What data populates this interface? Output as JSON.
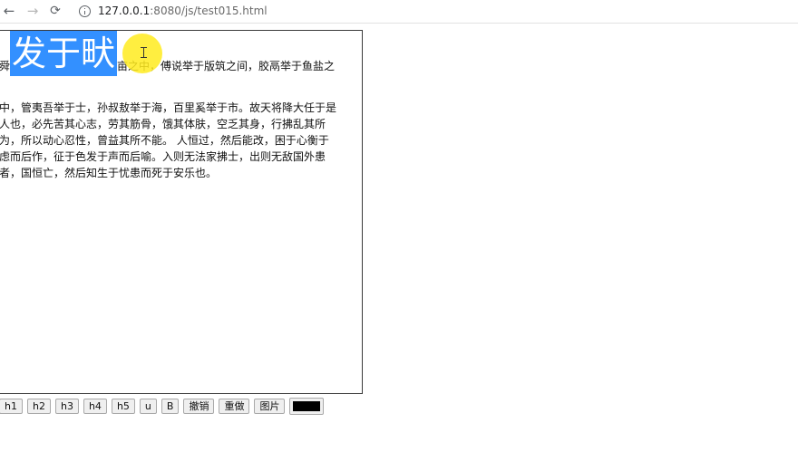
{
  "browser": {
    "url_host": "127.0.0.1",
    "url_path": ":8080/js/test015.html"
  },
  "editor": {
    "line1_a": "舜",
    "line1_selected": "发于畎",
    "line1_b": "亩之中，傅说举于版筑之间，胶鬲举于鱼盐之",
    "lines": [
      "中，管夷吾举于士，孙叔敖举于海，百里奚举于市。故天将降大任于是",
      "人也，必先苦其心志，劳其筋骨，饿其体肤，空乏其身，行拂乱其所",
      "为，所以动心忍性，曾益其所不能。 人恒过，然后能改，困于心衡于",
      "虑而后作，征于色发于声而后喻。入则无法家拂士，出则无敌国外患",
      "者，国恒亡，然后知生于忧患而死于安乐也。"
    ]
  },
  "toolbar": {
    "h1": "h1",
    "h2": "h2",
    "h3": "h3",
    "h4": "h4",
    "h5": "h5",
    "u": "u",
    "b": "B",
    "undo": "撤销",
    "redo": "重做",
    "image": "图片",
    "color_value": "#000000"
  },
  "icons": {
    "back": "arrow-left-icon",
    "forward": "arrow-right-icon",
    "reload": "reload-icon",
    "info": "info-icon"
  }
}
